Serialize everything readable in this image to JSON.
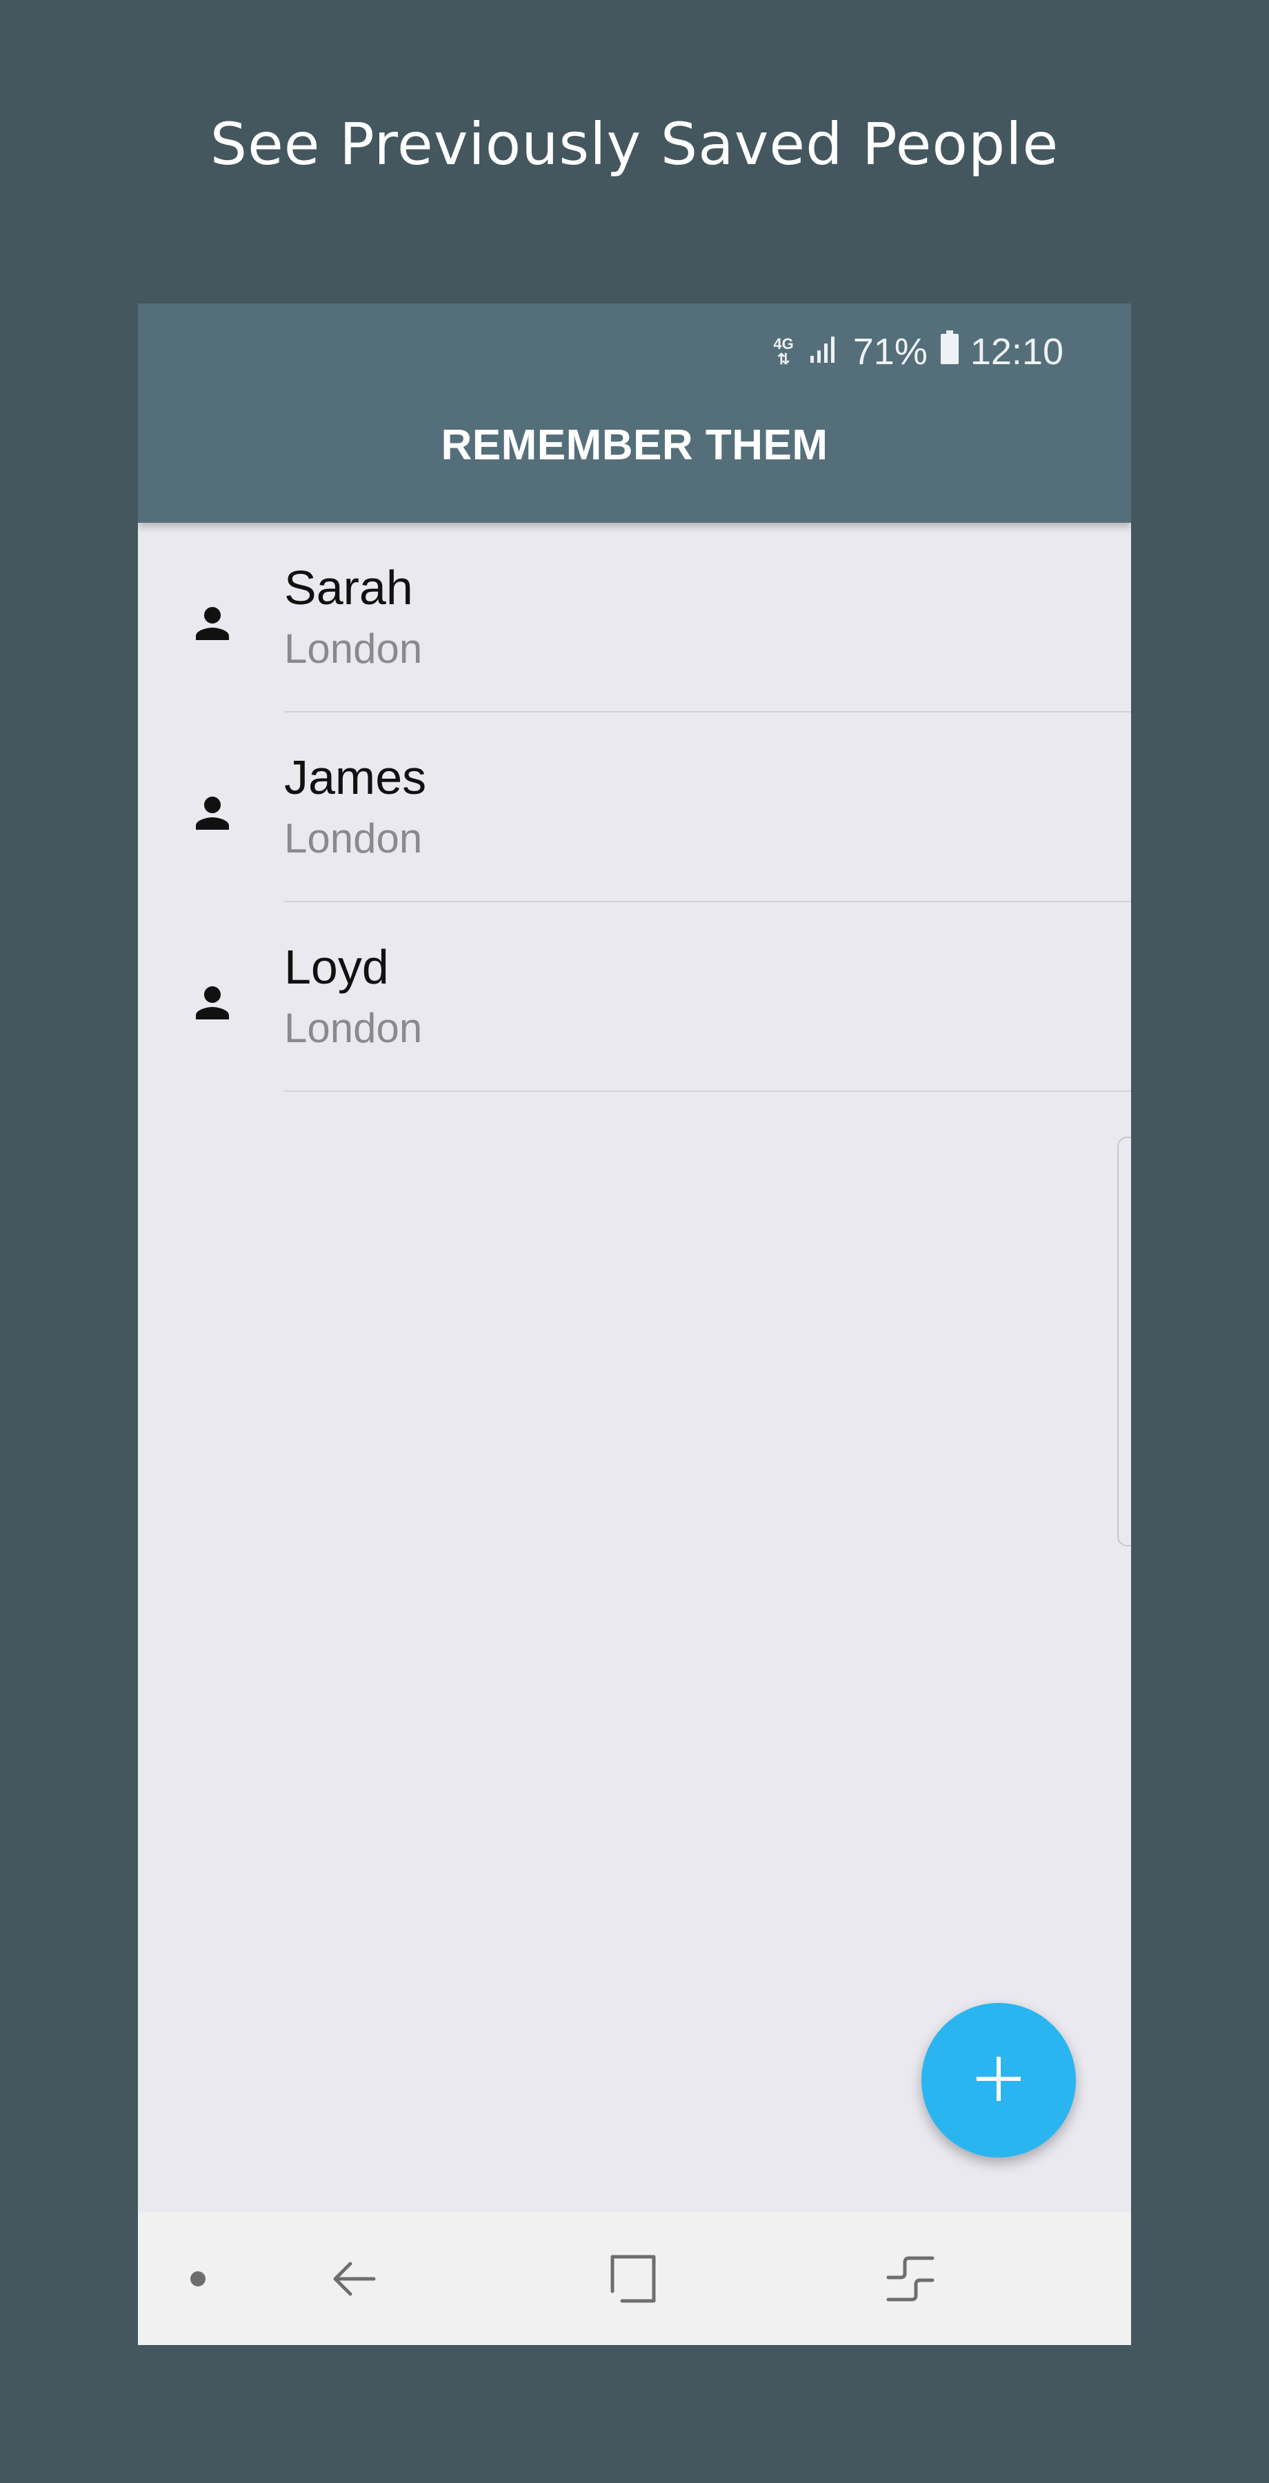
{
  "promo": {
    "heading": "See Previously Saved People"
  },
  "status_bar": {
    "network_type": "4G",
    "battery_percent": "71%",
    "time": "12:10",
    "icons": [
      "network-4g-icon",
      "signal-icon",
      "battery-icon"
    ]
  },
  "app_bar": {
    "title": "REMEMBER THEM"
  },
  "people": [
    {
      "name": "Sarah",
      "city": "London",
      "icon": "person-icon"
    },
    {
      "name": "James",
      "city": "London",
      "icon": "person-icon"
    },
    {
      "name": "Loyd",
      "city": "London",
      "icon": "person-icon"
    }
  ],
  "fab": {
    "icon": "plus-icon"
  },
  "nav_bar": {
    "items": [
      "dot-icon",
      "back-icon",
      "home-icon",
      "recents-icon"
    ]
  },
  "colors": {
    "background": "#44565e",
    "app_bar": "#546f7a",
    "list_background": "#eae9ef",
    "fab": "#2bb5f0",
    "nav_bar": "#f1f1f1"
  }
}
